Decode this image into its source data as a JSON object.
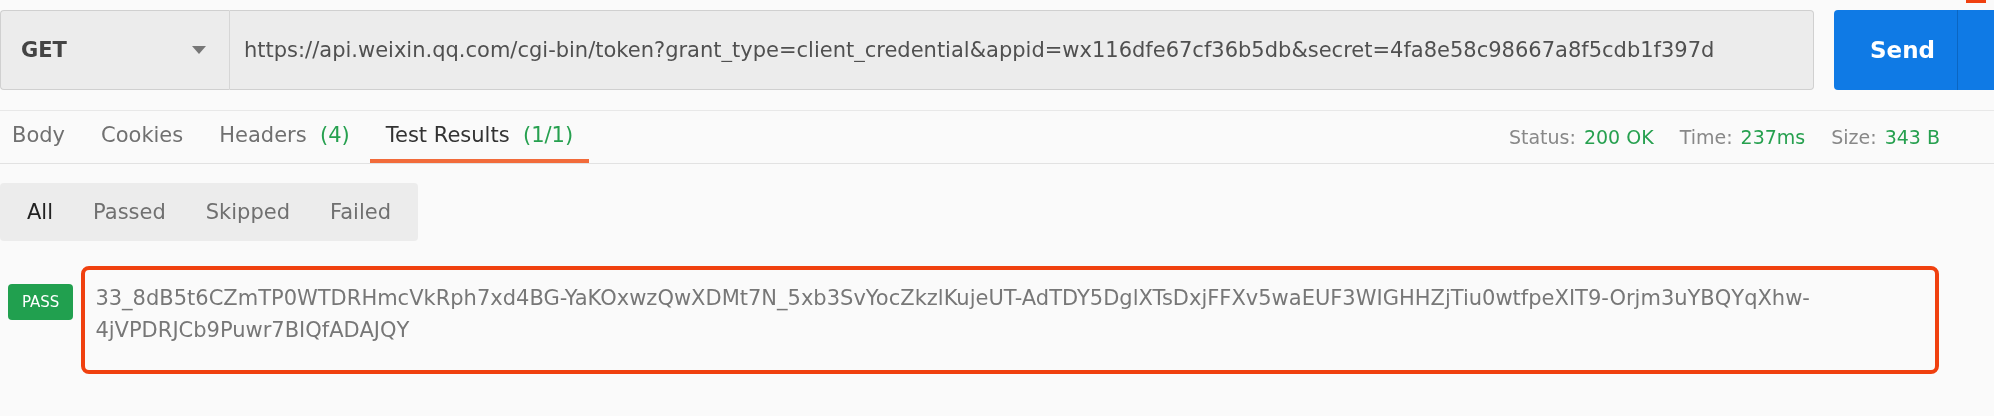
{
  "request": {
    "method": "GET",
    "url": "https://api.weixin.qq.com/cgi-bin/token?grant_type=client_credential&appid=wx116dfe67cf36b5db&secret=4fa8e58c98667a8f5cdb1f397d",
    "send_label": "Send"
  },
  "response_tabs": [
    {
      "label": "Body",
      "selected": false
    },
    {
      "label": "Cookies",
      "selected": false
    },
    {
      "label": "Headers",
      "count": "(4)",
      "selected": false
    },
    {
      "label": "Test Results",
      "count": "(1/1)",
      "selected": true
    }
  ],
  "status_bar": [
    {
      "label": "Status:",
      "value": "200 OK"
    },
    {
      "label": "Time:",
      "value": "237ms"
    },
    {
      "label": "Size:",
      "value": "343 B"
    }
  ],
  "filters": [
    {
      "label": "All",
      "selected": true
    },
    {
      "label": "Passed",
      "selected": false
    },
    {
      "label": "Skipped",
      "selected": false
    },
    {
      "label": "Failed",
      "selected": false
    }
  ],
  "results": [
    {
      "status": "PASS",
      "kind": "pass",
      "highlighted": true,
      "text": "33_8dB5t6CZmTP0WTDRHmcVkRph7xd4BG-YaKOxwzQwXDMt7N_5xb3SvYocZkzlKujeUT-AdTDY5DglXTsDxjFFXv5waEUF3WIGHHZjTiu0wtfpeXIT9-Orjm3uYBQYqXhw-4jVPDRJCb9Puwr7BIQfADAJQY"
    }
  ]
}
